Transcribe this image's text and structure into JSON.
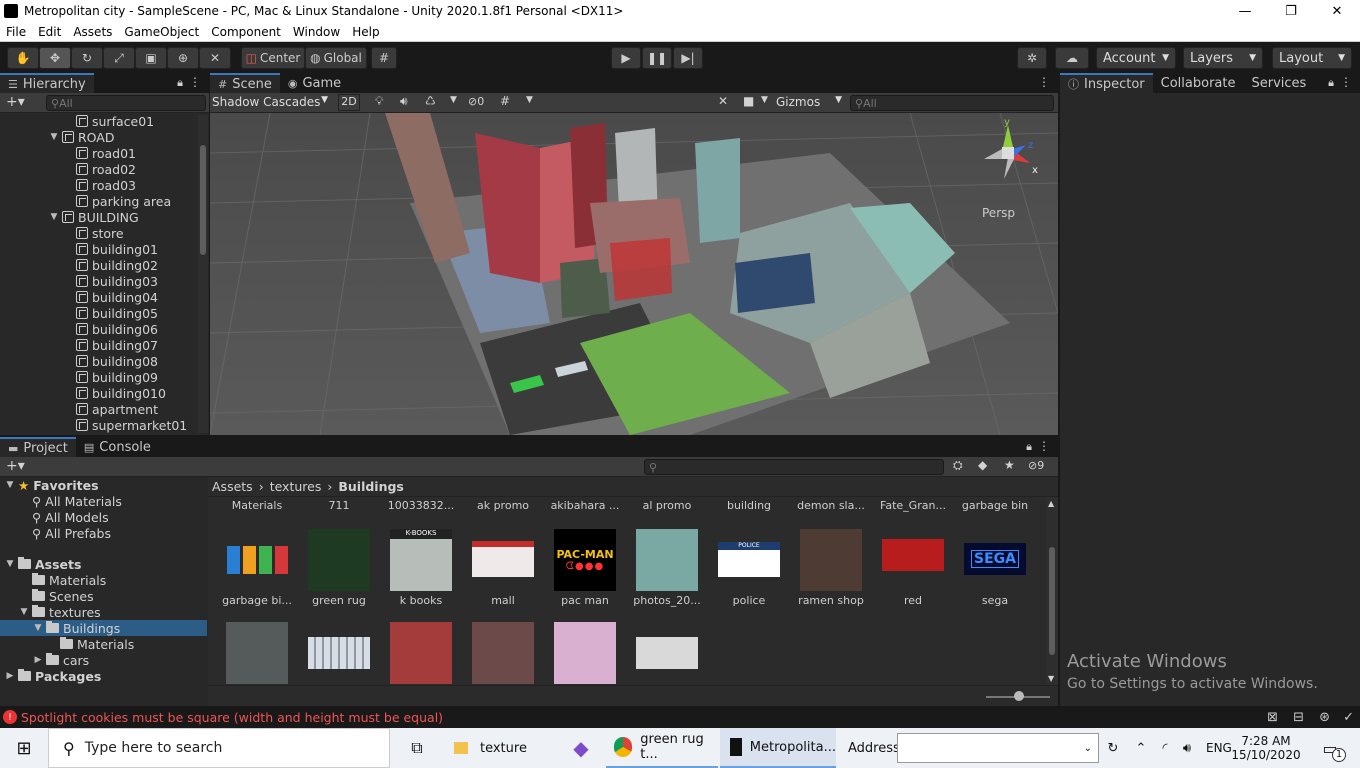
{
  "window": {
    "title": "Metropolitan city - SampleScene - PC, Mac & Linux Standalone - Unity 2020.1.8f1 Personal <DX11>"
  },
  "menu": [
    "File",
    "Edit",
    "Assets",
    "GameObject",
    "Component",
    "Window",
    "Help"
  ],
  "toolbar": {
    "center": "Center",
    "global": "Global",
    "account": "Account",
    "layers": "Layers",
    "layout": "Layout"
  },
  "hierarchy": {
    "tab": "Hierarchy",
    "search_placeholder": "All",
    "rows": [
      {
        "label": "surface01",
        "indent": 2,
        "kind": "obj"
      },
      {
        "label": "ROAD",
        "indent": 1,
        "kind": "group"
      },
      {
        "label": "road01",
        "indent": 2,
        "kind": "obj"
      },
      {
        "label": "road02",
        "indent": 2,
        "kind": "obj"
      },
      {
        "label": "road03",
        "indent": 2,
        "kind": "obj"
      },
      {
        "label": "parking area",
        "indent": 2,
        "kind": "obj"
      },
      {
        "label": "BUILDING",
        "indent": 1,
        "kind": "group"
      },
      {
        "label": "store",
        "indent": 2,
        "kind": "obj"
      },
      {
        "label": "building01",
        "indent": 2,
        "kind": "obj"
      },
      {
        "label": "building02",
        "indent": 2,
        "kind": "obj"
      },
      {
        "label": "building03",
        "indent": 2,
        "kind": "obj"
      },
      {
        "label": "building04",
        "indent": 2,
        "kind": "obj"
      },
      {
        "label": "building05",
        "indent": 2,
        "kind": "obj"
      },
      {
        "label": "building06",
        "indent": 2,
        "kind": "obj"
      },
      {
        "label": "building07",
        "indent": 2,
        "kind": "obj"
      },
      {
        "label": "building08",
        "indent": 2,
        "kind": "obj"
      },
      {
        "label": "building09",
        "indent": 2,
        "kind": "obj"
      },
      {
        "label": "building010",
        "indent": 2,
        "kind": "obj"
      },
      {
        "label": "apartment",
        "indent": 2,
        "kind": "obj"
      },
      {
        "label": "supermarket01",
        "indent": 2,
        "kind": "obj"
      }
    ]
  },
  "scene": {
    "tab_scene": "Scene",
    "tab_game": "Game",
    "shading": "Shadow Cascades",
    "mode_2d": "2D",
    "hidden_count": "0",
    "gizmos": "Gizmos",
    "search_placeholder": "All",
    "persp": "Persp",
    "axis_x": "x",
    "axis_y": "y",
    "axis_z": "z"
  },
  "inspector": {
    "tab": "Inspector",
    "collaborate": "Collaborate",
    "services": "Services"
  },
  "project": {
    "tab_project": "Project",
    "tab_console": "Console",
    "hidden_count": "9",
    "favorites": {
      "label": "Favorites",
      "items": [
        "All Materials",
        "All Models",
        "All Prefabs"
      ]
    },
    "tree": [
      {
        "label": "Assets",
        "level": 0,
        "bold": true
      },
      {
        "label": "Materials",
        "level": 1
      },
      {
        "label": "Scenes",
        "level": 1
      },
      {
        "label": "textures",
        "level": 1
      },
      {
        "label": "Buildings",
        "level": 2,
        "selected": true
      },
      {
        "label": "Materials",
        "level": 3
      },
      {
        "label": "cars",
        "level": 2
      },
      {
        "label": "Packages",
        "level": 0,
        "bold": true
      }
    ],
    "breadcrumb": [
      "Assets",
      "textures",
      "Buildings"
    ],
    "top_labels": [
      "Materials",
      "711",
      "10033832...",
      "ak promo",
      "akibahara ...",
      "al promo",
      "building",
      "demon sla...",
      "Fate_Gran...",
      "garbage bin"
    ],
    "grid_labels": [
      "garbage bi...",
      "green rug",
      "k books",
      "mall",
      "pac man",
      "photos_20...",
      "police",
      "ramen shop",
      "red",
      "sega"
    ],
    "thumb_text": {
      "pacman": "PAC-MAN",
      "sega": "SEGA",
      "police": "POLICE",
      "kbooks": "K-BOOKS"
    }
  },
  "status": {
    "message": "Spotlight cookies must be square (width and height must be equal)"
  },
  "watermark": {
    "line1": "Activate Windows",
    "line2": "Go to Settings to activate Windows."
  },
  "taskbar": {
    "search": "Type here to search",
    "explorer": "texture",
    "chrome": "green rug t...",
    "unity": "Metropolita...",
    "address": "Address",
    "lang": "ENG",
    "time": "7:28 AM",
    "date": "15/10/2020",
    "notif": "1"
  },
  "colors": {
    "accent": "#3a79bb",
    "error": "#e33",
    "editor_bg": "#282828"
  }
}
